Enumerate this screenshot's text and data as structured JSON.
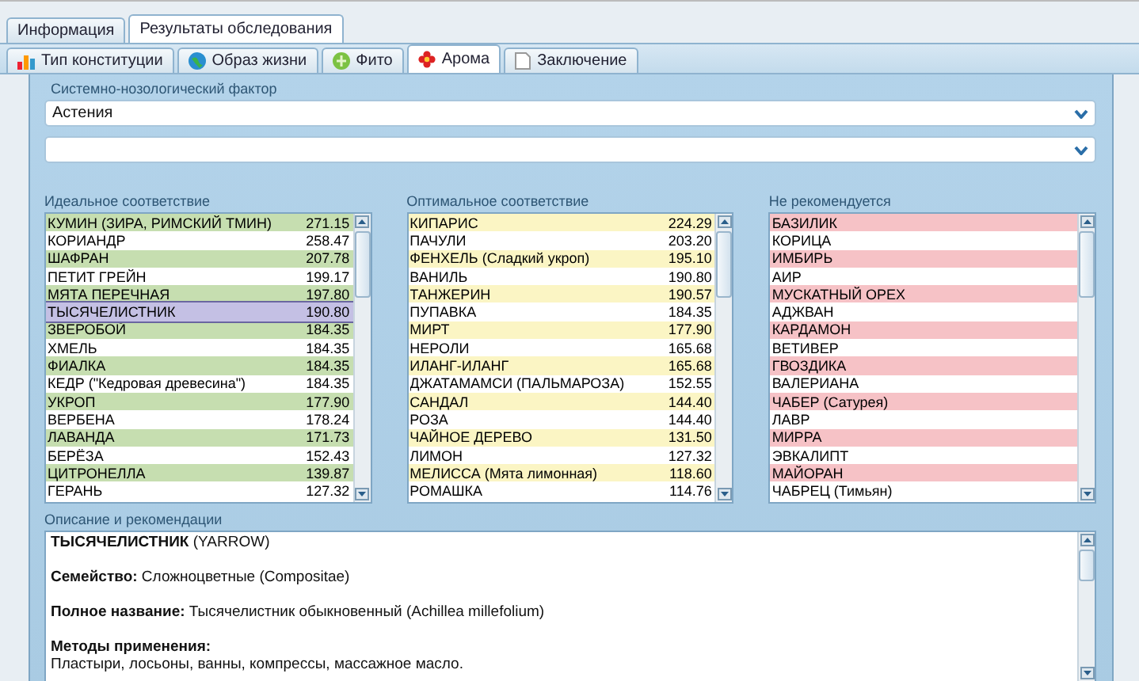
{
  "tabs": [
    {
      "label": "Информация",
      "selected": false
    },
    {
      "label": "Результаты обследования",
      "selected": true
    }
  ],
  "subtabs": [
    {
      "label": "Тип конституции",
      "selected": false
    },
    {
      "label": "Образ жизни",
      "selected": false
    },
    {
      "label": "Фито",
      "selected": false
    },
    {
      "label": "Арома",
      "selected": true
    },
    {
      "label": "Заключение",
      "selected": false
    }
  ],
  "filter": {
    "label": "Системно-нозологический фактор",
    "value": "Астения"
  },
  "lists": [
    {
      "kind": "ideal",
      "title": "Идеальное соответствие",
      "items": [
        {
          "name": "КУМИН (ЗИРА, РИМСКИЙ ТМИН)",
          "score": "271.15",
          "selected": false
        },
        {
          "name": "КОРИАНДР",
          "score": "258.47",
          "selected": false
        },
        {
          "name": "ШАФРАН",
          "score": "207.78",
          "selected": false
        },
        {
          "name": "ПЕТИТ ГРЕЙН",
          "score": "199.17",
          "selected": false
        },
        {
          "name": "МЯТА ПЕРЕЧНАЯ",
          "score": "197.80",
          "selected": false
        },
        {
          "name": "ТЫСЯЧЕЛИСТНИК",
          "score": "190.80",
          "selected": true
        },
        {
          "name": "ЗВЕРОБОЙ",
          "score": "184.35",
          "selected": false
        },
        {
          "name": "ХМЕЛЬ",
          "score": "184.35",
          "selected": false
        },
        {
          "name": "ФИАЛКА",
          "score": "184.35",
          "selected": false
        },
        {
          "name": "КЕДР (\"Кедровая древесина\")",
          "score": "184.35",
          "selected": false
        },
        {
          "name": "УКРОП",
          "score": "177.90",
          "selected": false
        },
        {
          "name": "ВЕРБЕНА",
          "score": "178.24",
          "selected": false
        },
        {
          "name": "ЛАВАНДА",
          "score": "171.73",
          "selected": false
        },
        {
          "name": "БЕРЁЗА",
          "score": "152.43",
          "selected": false
        },
        {
          "name": "ЦИТРОНЕЛЛА",
          "score": "139.87",
          "selected": false
        },
        {
          "name": "ГЕРАНЬ",
          "score": "127.32",
          "selected": false
        }
      ]
    },
    {
      "kind": "optimal",
      "title": "Оптимальное соответствие",
      "items": [
        {
          "name": "КИПАРИС",
          "score": "224.29",
          "selected": false
        },
        {
          "name": "ПАЧУЛИ",
          "score": "203.20",
          "selected": false
        },
        {
          "name": "ФЕНХЕЛЬ (Сладкий укроп)",
          "score": "195.10",
          "selected": false
        },
        {
          "name": "ВАНИЛЬ",
          "score": "190.80",
          "selected": false
        },
        {
          "name": "ТАНЖЕРИН",
          "score": "190.57",
          "selected": false
        },
        {
          "name": "ПУПАВКА",
          "score": "184.35",
          "selected": false
        },
        {
          "name": "МИРТ",
          "score": "177.90",
          "selected": false
        },
        {
          "name": "НЕРОЛИ",
          "score": "165.68",
          "selected": false
        },
        {
          "name": "ИЛАНГ-ИЛАНГ",
          "score": "165.68",
          "selected": false
        },
        {
          "name": "ДЖАТАМАМСИ (ПАЛЬМАРОЗА)",
          "score": "152.55",
          "selected": false
        },
        {
          "name": "САНДАЛ",
          "score": "144.40",
          "selected": false
        },
        {
          "name": "РОЗА",
          "score": "144.40",
          "selected": false
        },
        {
          "name": "ЧАЙНОЕ ДЕРЕВО",
          "score": "131.50",
          "selected": false
        },
        {
          "name": "ЛИМОН",
          "score": "127.32",
          "selected": false
        },
        {
          "name": "МЕЛИССА (Мята лимонная)",
          "score": "118.60",
          "selected": false
        },
        {
          "name": "РОМАШКА",
          "score": "114.76",
          "selected": false
        }
      ]
    },
    {
      "kind": "not_recommended",
      "title": "Не рекомендуется",
      "items": [
        {
          "name": "БАЗИЛИК",
          "selected": false
        },
        {
          "name": "КОРИЦА",
          "selected": false
        },
        {
          "name": "ИМБИРЬ",
          "selected": false
        },
        {
          "name": "АИР",
          "selected": false
        },
        {
          "name": "МУСКАТНЫЙ ОРЕХ",
          "selected": false
        },
        {
          "name": "АДЖВАН",
          "selected": false
        },
        {
          "name": "КАРДАМОН",
          "selected": false
        },
        {
          "name": "ВЕТИВЕР",
          "selected": false
        },
        {
          "name": "ГВОЗДИКА",
          "selected": false
        },
        {
          "name": "ВАЛЕРИАНА",
          "selected": false
        },
        {
          "name": "ЧАБЕР (Сатурея)",
          "selected": false
        },
        {
          "name": "ЛАВР",
          "selected": false
        },
        {
          "name": "МИРРА",
          "selected": false
        },
        {
          "name": "ЭВКАЛИПТ",
          "selected": false
        },
        {
          "name": "МАЙОРАН",
          "selected": false
        },
        {
          "name": "ЧАБРЕЦ (Тимьян)",
          "selected": false
        }
      ]
    }
  ],
  "description": {
    "label": "Описание и рекомендации",
    "lines": [
      {
        "kind": "para",
        "text": "**ТЫСЯЧЕЛИСТНИК** (YARROW)"
      },
      {
        "kind": "para",
        "text": "**Семейство:** Сложноцветные (Compositae)"
      },
      {
        "kind": "para",
        "text": "**Полное название:** Тысячелистник обыкновенный (Achillea millefolium)"
      },
      {
        "kind": "heading",
        "text": "Методы применения:"
      },
      {
        "kind": "para",
        "text": "Пластыри, лосьоны, ванны, компрессы, массажное масло."
      }
    ]
  }
}
